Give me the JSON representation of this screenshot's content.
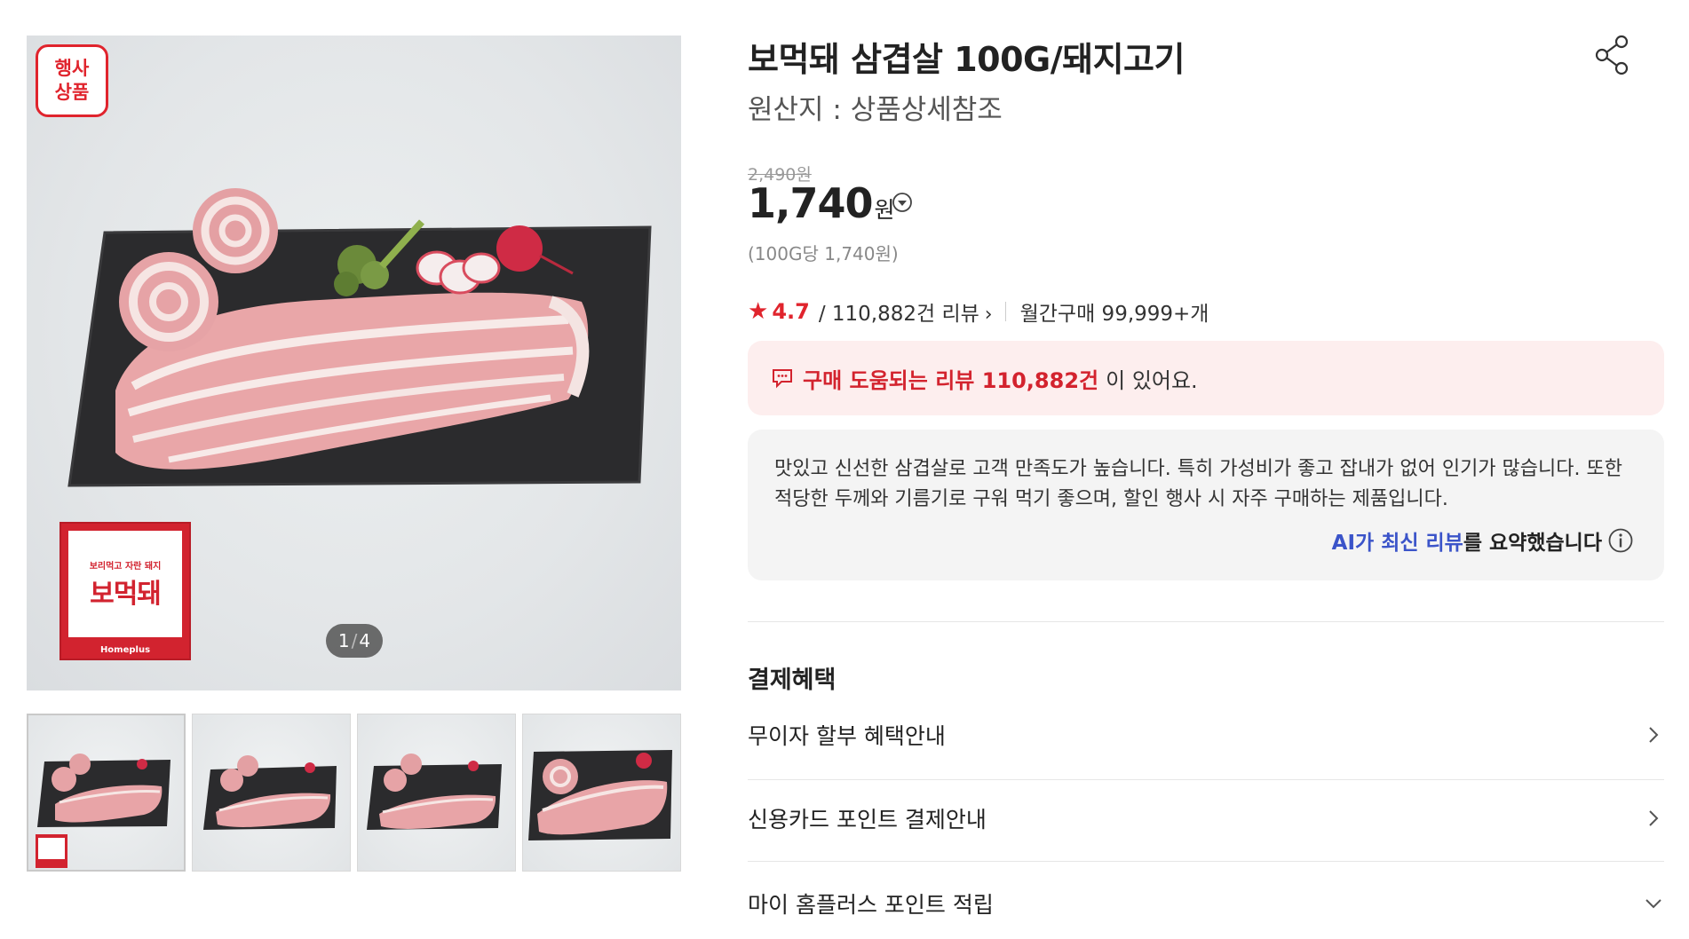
{
  "gallery": {
    "event_badge": [
      "행사",
      "상품"
    ],
    "counter_current": "1",
    "counter_total": "4",
    "brand_logo": {
      "tagline": "보리먹고 자란 돼지",
      "name": "보먹돼",
      "sub": "Homeplus"
    },
    "thumbnails_count": 4
  },
  "product": {
    "title": "보먹돼 삼겹살 100G/돼지고기",
    "origin": "원산지 : 상품상세참조",
    "original_price": "2,490원",
    "price": "1,740",
    "price_unit": "원",
    "unit_price": "(100G당 1,740원)",
    "rating": "4.7",
    "review_count": "/ 110,882건 리뷰",
    "monthly_purchase": "월간구매 99,999+개"
  },
  "review_banner": {
    "highlight": "구매 도움되는 리뷰 110,882건",
    "rest": "이 있어요."
  },
  "ai_summary": {
    "text": "맛있고 신선한 삼겹살로 고객 만족도가 높습니다. 특히 가성비가 좋고 잡내가 없어 인기가 많습니다. 또한 적당한 두께와 기름기로 구워 먹기 좋으며, 할인 행사 시 자주 구매하는 제품입니다.",
    "credit_ai": "AI가 최신 리뷰",
    "credit_rest": "를 요약했습니다"
  },
  "benefits": {
    "title": "결제혜택",
    "items": [
      {
        "label": "무이자 할부 혜택안내"
      },
      {
        "label": "신용카드 포인트 결제안내"
      },
      {
        "label": "마이 홈플러스 포인트 적립"
      }
    ]
  },
  "colors": {
    "accent_red": "#e0242d",
    "ai_blue": "#3b54c9",
    "banner_bg": "#fdeeee",
    "summary_bg": "#f4f4f4"
  }
}
